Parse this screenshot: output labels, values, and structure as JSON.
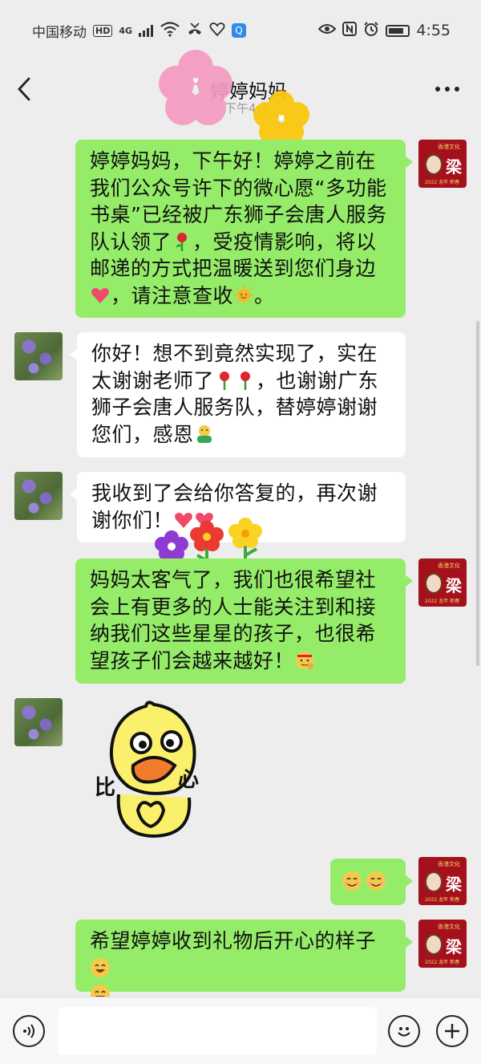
{
  "status_bar": {
    "carrier": "中国移动",
    "hd": "HD",
    "network": "4G",
    "wifi_label": "6",
    "time": "4:55"
  },
  "header": {
    "title": "婷婷妈妈",
    "timestamp": "下午4:4"
  },
  "messages": [
    {
      "side": "right",
      "text_before": "婷婷妈妈，下午好！婷婷之前在我们公众号许下的微心愿“多功能书桌”已经被广东狮子会唐人服务队认领了",
      "emoji1": "rose-emoji",
      "text_mid": "，受疫情影响，将以邮递的方式把温暖送到您们身边",
      "emoji2": "heart-emoji",
      "text_mid2": "，请注意查收",
      "emoji3": "sun-emoji",
      "text_end": "。"
    },
    {
      "side": "left",
      "text_before": "你好！想不到竟然实现了，实在太谢谢老师了",
      "emoji1": "rose-emoji",
      "text_mid": "，也谢谢广东狮子会唐人服务队，替婷婷谢谢您们，感恩",
      "emoji2": "hug-emoji"
    },
    {
      "side": "left",
      "text_before": "我收到了会给你答复的，再次谢谢你们！",
      "emoji1": "hearts-emoji"
    },
    {
      "side": "right",
      "text_before": "妈妈太客气了，我们也很希望社会上有更多的人士能关注到和接纳我们这些星星的孩子，也很希望孩子们会越来越好！",
      "emoji1": "salute-emoji"
    },
    {
      "side": "left",
      "sticker": "duck-heart-sticker",
      "sticker_text": "比心"
    },
    {
      "side": "right",
      "emoji1": "smile-emoji"
    },
    {
      "side": "right",
      "text_before": "希望婷婷收到礼物后开心的样子",
      "emoji1": "happy-emoji"
    }
  ],
  "avatar_me": {
    "char": "梁",
    "top_text": "香港文化",
    "bottom_text": "2022 龙年 新春"
  },
  "colors": {
    "my_bubble": "#95ec69",
    "their_bubble": "#ffffff",
    "background": "#ededed"
  }
}
